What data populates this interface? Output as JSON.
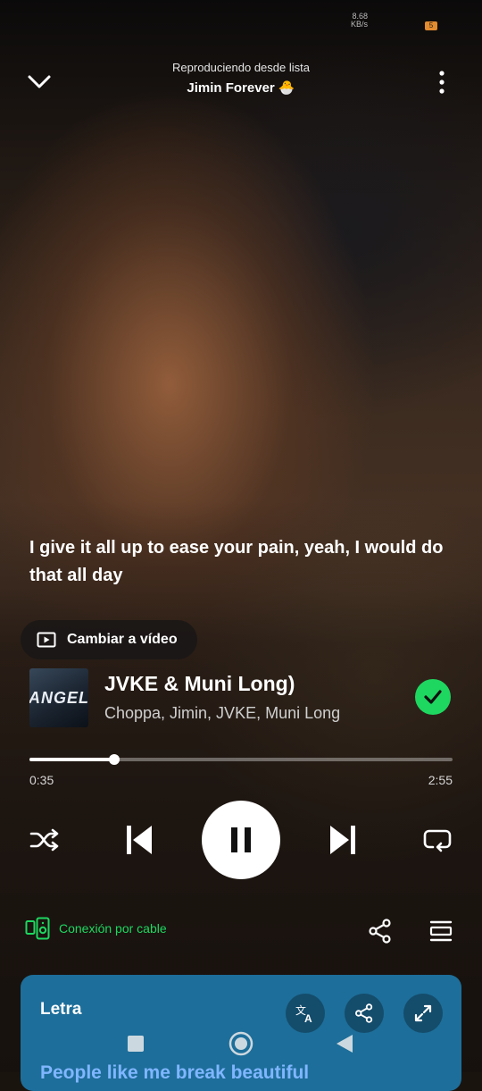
{
  "status": {
    "speed": "8.68\nKB/s",
    "battery": "5"
  },
  "header": {
    "subtitle": "Reproduciendo desde lista",
    "playlist": "Jimin Forever 🐣"
  },
  "lyric_line": "I give it all up to ease your pain, yeah, I would do that all day",
  "video_button": {
    "label": "Cambiar a vídeo"
  },
  "track": {
    "title": "JVKE & Muni Long)",
    "artists": "Choppa, Jimin, JVKE, Muni Long",
    "cover_text": "ANGEL"
  },
  "playback": {
    "elapsed": "0:35",
    "duration": "2:55",
    "progress": 0.2
  },
  "device": {
    "label": "Conexión por cable"
  },
  "lyrics_card": {
    "label": "Letra",
    "peek": "People like me break beautiful"
  },
  "colors": {
    "accent": "#1ed760",
    "card": "#1d6e9a"
  },
  "icons": [
    "chevron-down-icon",
    "more-vertical-icon",
    "video-icon",
    "check-icon",
    "shuffle-icon",
    "previous-icon",
    "pause-icon",
    "next-icon",
    "repeat-icon",
    "cable-device-icon",
    "share-icon",
    "queue-icon",
    "translate-icon",
    "expand-icon",
    "nav-square-icon",
    "nav-circle-icon",
    "nav-back-icon"
  ]
}
